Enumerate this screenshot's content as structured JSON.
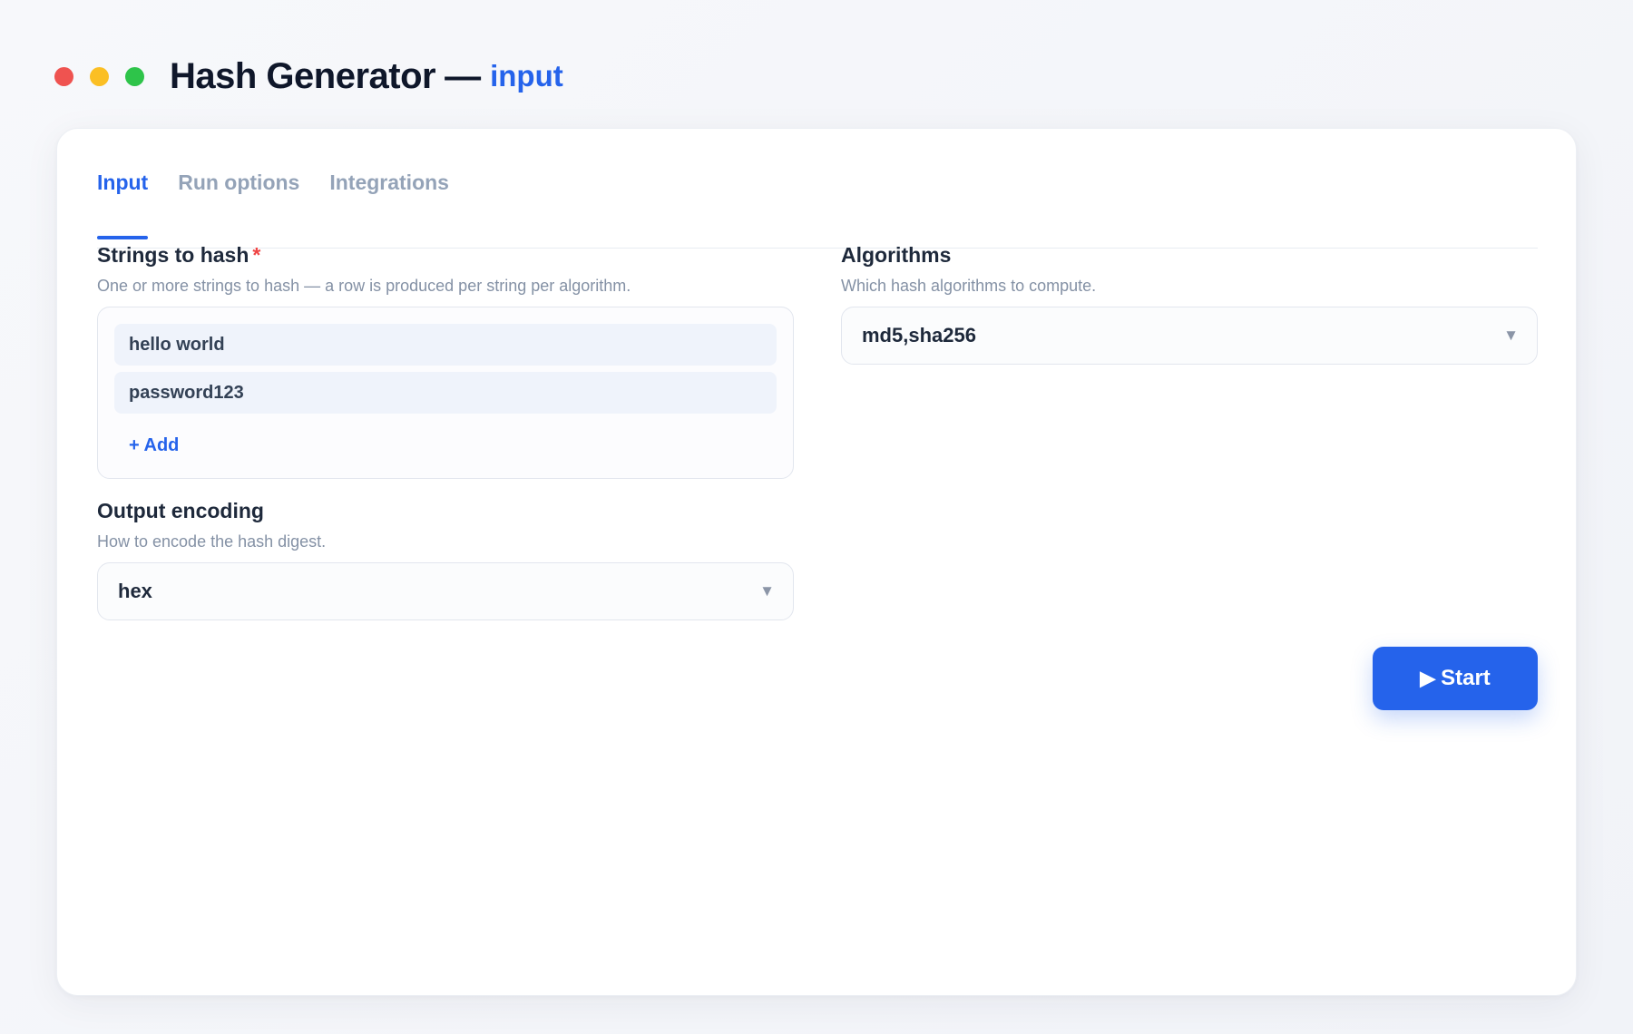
{
  "window": {
    "title": "Hash Generator",
    "separator": "—",
    "subtitle": "input",
    "controls": {
      "close_color": "#ef5350",
      "minimize_color": "#fbbf24",
      "maximize_color": "#2ec44a"
    }
  },
  "colors": {
    "accent": "#2563eb",
    "required": "#ef4444"
  },
  "tabs": [
    {
      "label": "Input",
      "active": true
    },
    {
      "label": "Run options",
      "active": false
    },
    {
      "label": "Integrations",
      "active": false
    }
  ],
  "form": {
    "strings": {
      "label": "Strings to hash",
      "required_marker": "*",
      "hint": "One or more strings to hash — a row is produced per string per algorithm.",
      "items": [
        "hello world",
        "password123"
      ],
      "add_label": "+ Add"
    },
    "algorithms": {
      "label": "Algorithms",
      "hint": "Which hash algorithms to compute.",
      "value": "md5,sha256",
      "caret": "▼"
    },
    "encoding": {
      "label": "Output encoding",
      "hint": "How to encode the hash digest.",
      "value": "hex",
      "caret": "▼"
    }
  },
  "actions": {
    "start_icon": "▶",
    "start_label": "Start"
  }
}
